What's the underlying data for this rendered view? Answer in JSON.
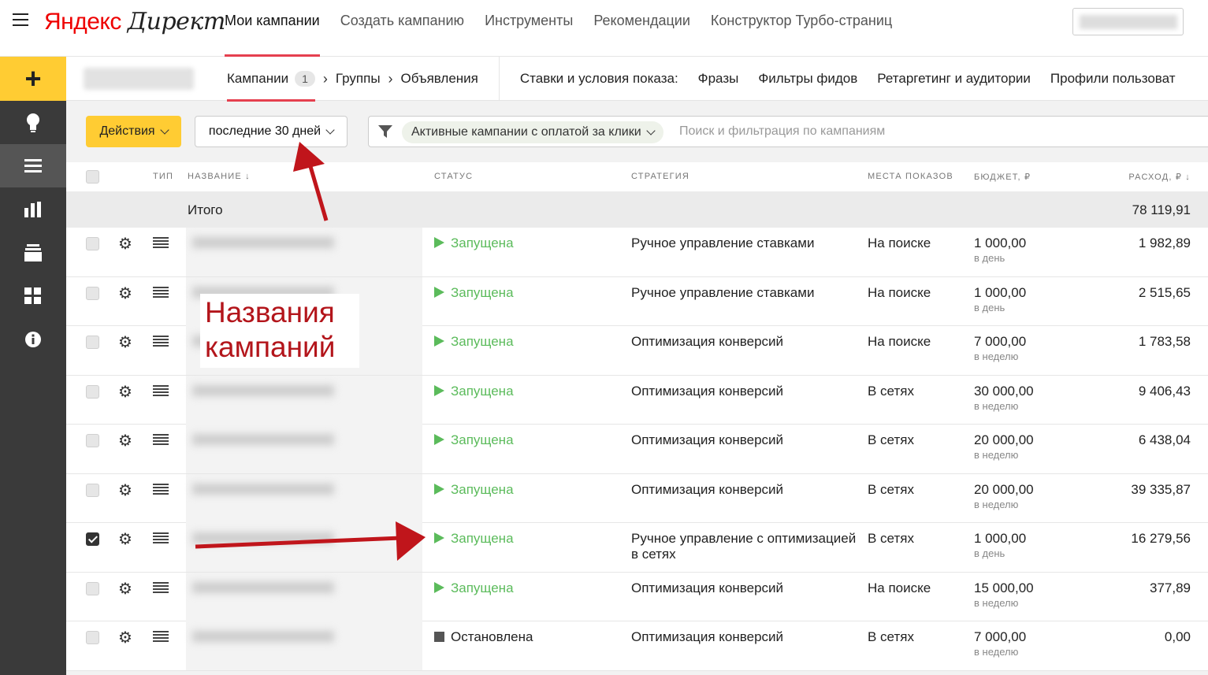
{
  "header": {
    "logo_ya": "Яндекс",
    "logo_direct": "Директ",
    "nav": [
      "Мои кампании",
      "Создать кампанию",
      "Инструменты",
      "Рекомендации",
      "Конструктор Турбо-страниц"
    ]
  },
  "sidebar": {
    "items": [
      "plus-icon",
      "lightbulb-icon",
      "list-icon",
      "bar-chart-icon",
      "stack-icon",
      "grid-icon",
      "info-icon"
    ]
  },
  "tabbar": {
    "campaigns_label": "Кампании",
    "campaigns_count": "1",
    "groups_label": "Группы",
    "ads_label": "Объявления",
    "right_items": [
      "Ставки и условия показа:",
      "Фразы",
      "Фильтры фидов",
      "Ретаргетинг и аудитории",
      "Профили пользоват"
    ]
  },
  "filters": {
    "actions_label": "Действия",
    "period_label": "последние 30 дней",
    "chip_label": "Активные кампании с оплатой за клики",
    "search_placeholder": "Поиск и фильтрация по кампаниям"
  },
  "table": {
    "headers": {
      "type": "ТИП",
      "name": "НАЗВАНИЕ",
      "status": "СТАТУС",
      "strategy": "СТРАТЕГИЯ",
      "places": "МЕСТА ПОКАЗОВ",
      "budget": "БЮДЖЕТ, ₽",
      "spend": "РАСХОД, ₽"
    },
    "total_label": "Итого",
    "total_value": "78 119,91",
    "rows": [
      {
        "checked": false,
        "status": "Запущена",
        "running": true,
        "strategy": "Ручное управление ставками",
        "place": "На поиске",
        "budget": "1 000,00",
        "period": "в день",
        "spend": "1 982,89"
      },
      {
        "checked": false,
        "status": "Запущена",
        "running": true,
        "strategy": "Ручное управление ставками",
        "place": "На поиске",
        "budget": "1 000,00",
        "period": "в день",
        "spend": "2 515,65"
      },
      {
        "checked": false,
        "status": "Запущена",
        "running": true,
        "strategy": "Оптимизация конверсий",
        "place": "На поиске",
        "budget": "7 000,00",
        "period": "в неделю",
        "spend": "1 783,58"
      },
      {
        "checked": false,
        "status": "Запущена",
        "running": true,
        "strategy": "Оптимизация конверсий",
        "place": "В сетях",
        "budget": "30 000,00",
        "period": "в неделю",
        "spend": "9 406,43"
      },
      {
        "checked": false,
        "status": "Запущена",
        "running": true,
        "strategy": "Оптимизация конверсий",
        "place": "В сетях",
        "budget": "20 000,00",
        "period": "в неделю",
        "spend": "6 438,04"
      },
      {
        "checked": false,
        "status": "Запущена",
        "running": true,
        "strategy": "Оптимизация конверсий",
        "place": "В сетях",
        "budget": "20 000,00",
        "period": "в неделю",
        "spend": "39 335,87"
      },
      {
        "checked": true,
        "status": "Запущена",
        "running": true,
        "strategy": "Ручное управление с оптимизацией в сетях",
        "place": "В сетях",
        "budget": "1 000,00",
        "period": "в день",
        "spend": "16 279,56"
      },
      {
        "checked": false,
        "status": "Запущена",
        "running": true,
        "strategy": "Оптимизация конверсий",
        "place": "На поиске",
        "budget": "15 000,00",
        "period": "в неделю",
        "spend": "377,89"
      },
      {
        "checked": false,
        "status": "Остановлена",
        "running": false,
        "strategy": "Оптимизация конверсий",
        "place": "В сетях",
        "budget": "7 000,00",
        "period": "в неделю",
        "spend": "0,00"
      }
    ]
  },
  "annotation": {
    "note_line1": "Названия",
    "note_line2": "кампаний",
    "color": "#b3151b"
  },
  "colors": {
    "accent": "#ffcc33",
    "active_underline": "#e5404f",
    "running_status": "#5bbb5b",
    "sidebar": "#3a3a3a"
  }
}
